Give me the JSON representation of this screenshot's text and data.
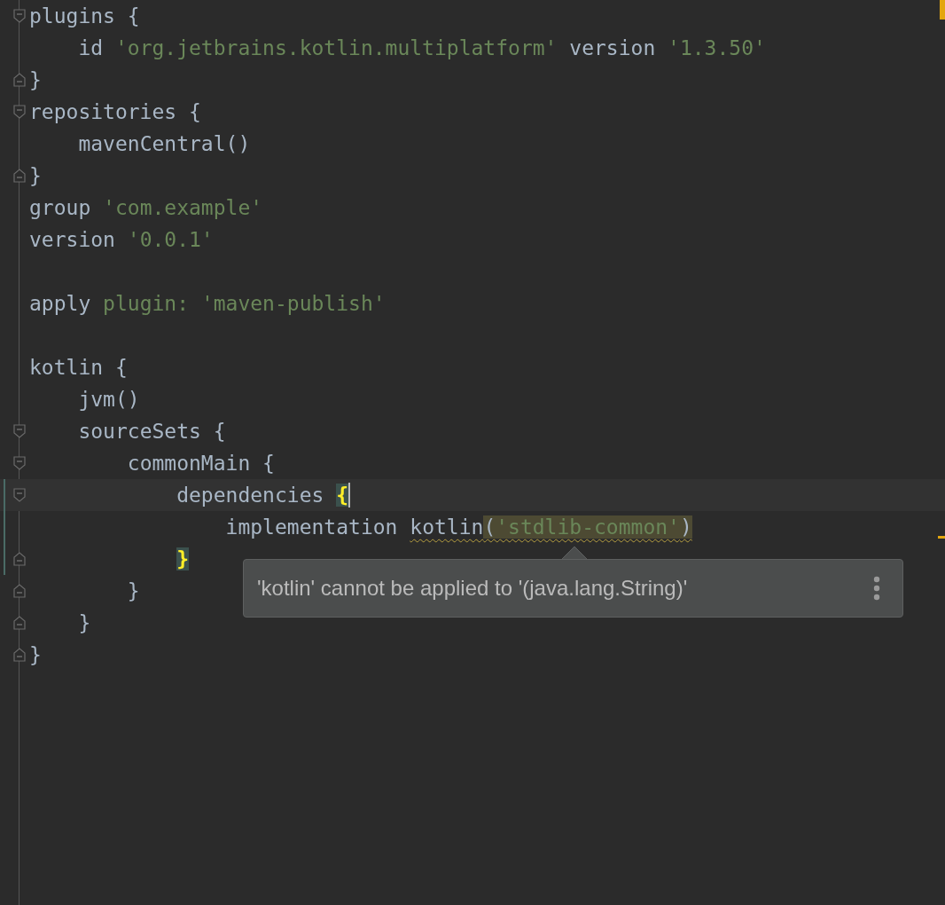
{
  "editor": {
    "has_warnings": true,
    "lines": [
      {
        "fold_start": true,
        "changed": false,
        "current": false,
        "tokens": [
          {
            "text": "plugins {",
            "kind": "plain"
          }
        ]
      },
      {
        "changed": false,
        "current": false,
        "tokens": [
          {
            "text": "    id ",
            "kind": "plain"
          },
          {
            "text": "'org.jetbrains.kotlin.multiplatform'",
            "kind": "string"
          },
          {
            "text": " version ",
            "kind": "plain"
          },
          {
            "text": "'1.3.50'",
            "kind": "string"
          }
        ]
      },
      {
        "fold_end": true,
        "changed": false,
        "current": false,
        "tokens": [
          {
            "text": "}",
            "kind": "plain"
          }
        ]
      },
      {
        "fold_start": true,
        "changed": false,
        "current": false,
        "tokens": [
          {
            "text": "repositories {",
            "kind": "plain"
          }
        ]
      },
      {
        "changed": false,
        "current": false,
        "tokens": [
          {
            "text": "    mavenCentral()",
            "kind": "plain"
          }
        ]
      },
      {
        "fold_end": true,
        "changed": false,
        "current": false,
        "tokens": [
          {
            "text": "}",
            "kind": "plain"
          }
        ]
      },
      {
        "changed": false,
        "current": false,
        "tokens": [
          {
            "text": "group ",
            "kind": "plain"
          },
          {
            "text": "'com.example'",
            "kind": "string"
          }
        ]
      },
      {
        "changed": false,
        "current": false,
        "tokens": [
          {
            "text": "version ",
            "kind": "plain"
          },
          {
            "text": "'0.0.1'",
            "kind": "string"
          }
        ]
      },
      {
        "changed": false,
        "current": false
      },
      {
        "changed": false,
        "current": false,
        "tokens": [
          {
            "text": "apply ",
            "kind": "plain"
          },
          {
            "text": "plugin: ",
            "kind": "named-arg"
          },
          {
            "text": "'maven-publish'",
            "kind": "string"
          }
        ]
      },
      {
        "changed": false,
        "current": false
      },
      {
        "changed": false,
        "current": false,
        "tokens": [
          {
            "text": "kotlin {",
            "kind": "plain"
          }
        ]
      },
      {
        "changed": false,
        "current": false,
        "tokens": [
          {
            "text": "    jvm()",
            "kind": "plain"
          }
        ]
      },
      {
        "fold_start": true,
        "changed": false,
        "current": false,
        "tokens": [
          {
            "text": "    sourceSets {",
            "kind": "plain"
          }
        ]
      },
      {
        "fold_start": true,
        "changed": false,
        "current": false,
        "tokens": [
          {
            "text": "        commonMain {",
            "kind": "plain"
          }
        ]
      },
      {
        "fold_start": true,
        "changed": true,
        "current": true,
        "tokens": [
          {
            "text": "            dependencies ",
            "kind": "plain"
          },
          {
            "text": "{",
            "kind": "brace-match",
            "caret_after": true
          }
        ]
      },
      {
        "changed": true,
        "current": false,
        "tokens": [
          {
            "text": "                implementation ",
            "kind": "plain"
          },
          {
            "text": "kotlin",
            "kind": "plain",
            "underline": true
          },
          {
            "text": "(",
            "kind": "plain",
            "underline": true,
            "highlighted": true
          },
          {
            "text": "'stdlib-common'",
            "kind": "string",
            "underline": true,
            "highlighted": true
          },
          {
            "text": ")",
            "kind": "plain",
            "underline": true,
            "highlighted": true
          }
        ]
      },
      {
        "fold_end": true,
        "changed": true,
        "current": false,
        "tokens": [
          {
            "text": "            }",
            "kind": "brace-match"
          }
        ]
      },
      {
        "fold_end": true,
        "changed": false,
        "current": false,
        "tokens": [
          {
            "text": "        }",
            "kind": "plain"
          }
        ]
      },
      {
        "fold_end": true,
        "changed": false,
        "current": false,
        "tokens": [
          {
            "text": "    }",
            "kind": "plain"
          }
        ]
      },
      {
        "fold_end": true,
        "changed": false,
        "current": false,
        "tokens": [
          {
            "text": "}",
            "kind": "plain"
          }
        ]
      }
    ]
  },
  "tooltip": {
    "message": "'kotlin' cannot be applied to '(java.lang.String)'"
  }
}
